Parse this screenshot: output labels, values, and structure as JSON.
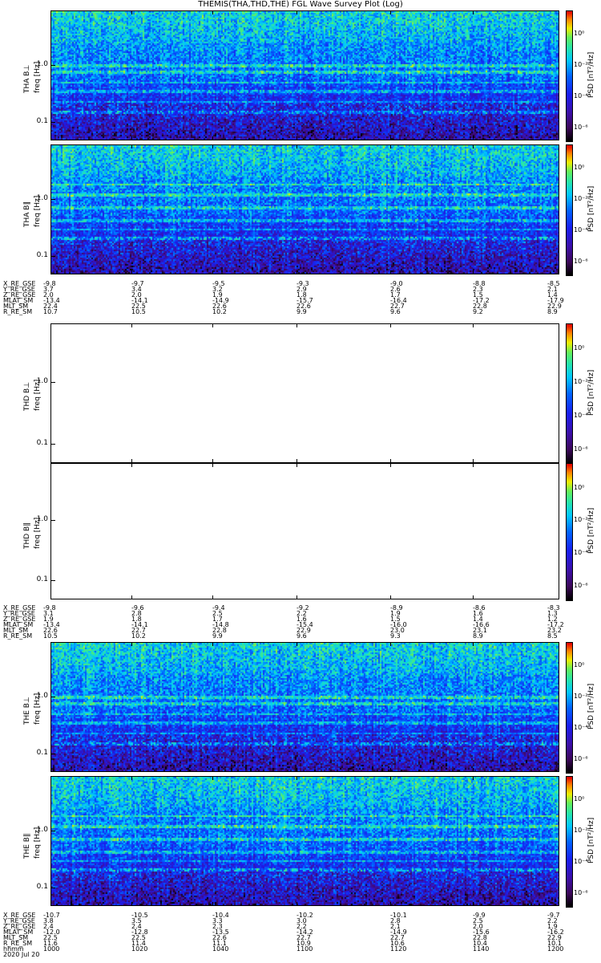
{
  "chart_data": {
    "type": "heatmap",
    "title": "THEMIS(THA,THD,THE) FGL Wave Survey Plot (Log)",
    "y_scale": "log",
    "y_tick_labels": [
      "1.0",
      "0.1"
    ],
    "colorbar": {
      "label": "PSD [nT²/Hz]",
      "scale": "log",
      "tick_labels": [
        "10⁰",
        "10⁻²",
        "10⁻⁴",
        "10⁻⁶"
      ],
      "colormap": [
        "#000000",
        "#3a0a5c",
        "#3a10a8",
        "#1e1ef0",
        "#0060ff",
        "#00c8ff",
        "#30e8a0",
        "#60f060",
        "#f0f000",
        "#ff8000",
        "#ff0000"
      ]
    },
    "panels": [
      {
        "probe_label": "THA B⊥",
        "freq_label": "freq [Hz]",
        "has_data": true
      },
      {
        "probe_label": "THA B∥",
        "freq_label": "freq [Hz]",
        "has_data": true
      },
      {
        "probe_label": "THD B⊥",
        "freq_label": "freq [Hz]",
        "has_data": false
      },
      {
        "probe_label": "THD B∥",
        "freq_label": "freq [Hz]",
        "has_data": false
      },
      {
        "probe_label": "THE B⊥",
        "freq_label": "freq [Hz]",
        "has_data": true
      },
      {
        "probe_label": "THE B∥",
        "freq_label": "freq [Hz]",
        "has_data": true
      }
    ],
    "ephemeris": [
      {
        "probe": "THA",
        "rows": [
          {
            "name": "X_RE_GSE",
            "values": [
              "-9.8",
              "-9.7",
              "-9.5",
              "-9.3",
              "-9.0",
              "-8.8",
              "-8.5"
            ]
          },
          {
            "name": "Y_RE_GSE",
            "values": [
              "3.7",
              "3.4",
              "3.2",
              "2.9",
              "2.6",
              "2.3",
              "2.1"
            ]
          },
          {
            "name": "Z_RE_GSE",
            "values": [
              "2.0",
              "2.0",
              "1.9",
              "1.8",
              "1.7",
              "1.5",
              "1.4"
            ]
          },
          {
            "name": "MLAT_SM",
            "values": [
              "-13.4",
              "-14.1",
              "-14.9",
              "-15.7",
              "-16.4",
              "-17.2",
              "-17.9"
            ]
          },
          {
            "name": "MLT_SM",
            "values": [
              "22.4",
              "22.5",
              "22.6",
              "22.6",
              "22.7",
              "22.8",
              "22.9"
            ]
          },
          {
            "name": "R_RE_SM",
            "values": [
              "10.7",
              "10.5",
              "10.2",
              "9.9",
              "9.6",
              "9.2",
              "8.9"
            ]
          }
        ]
      },
      {
        "probe": "THD",
        "rows": [
          {
            "name": "X_RE_GSE",
            "values": [
              "-9.8",
              "-9.6",
              "-9.4",
              "-9.2",
              "-8.9",
              "-8.6",
              "-8.3"
            ]
          },
          {
            "name": "Y_RE_GSE",
            "values": [
              "3.1",
              "2.8",
              "2.5",
              "2.2",
              "1.9",
              "1.6",
              "1.3"
            ]
          },
          {
            "name": "Z_RE_GSE",
            "values": [
              "1.9",
              "1.8",
              "1.7",
              "1.6",
              "1.5",
              "1.4",
              "1.2"
            ]
          },
          {
            "name": "MLAT_SM",
            "values": [
              "-13.4",
              "-14.1",
              "-14.8",
              "-15.4",
              "-16.0",
              "-16.6",
              "-17.2"
            ]
          },
          {
            "name": "MLT_SM",
            "values": [
              "22.6",
              "22.7",
              "22.8",
              "22.9",
              "23.0",
              "23.1",
              "23.2"
            ]
          },
          {
            "name": "R_RE_SM",
            "values": [
              "10.5",
              "10.2",
              "9.9",
              "9.6",
              "9.3",
              "8.9",
              "8.5"
            ]
          }
        ]
      },
      {
        "probe": "THE",
        "rows": [
          {
            "name": "X_RE_GSE",
            "values": [
              "-10.7",
              "-10.5",
              "-10.4",
              "-10.2",
              "-10.1",
              "-9.9",
              "-9.7"
            ]
          },
          {
            "name": "Y_RE_GSE",
            "values": [
              "3.8",
              "3.5",
              "3.3",
              "3.0",
              "2.8",
              "2.5",
              "2.2"
            ]
          },
          {
            "name": "Z_RE_GSE",
            "values": [
              "2.4",
              "2.4",
              "2.3",
              "2.2",
              "2.1",
              "2.0",
              "1.9"
            ]
          },
          {
            "name": "MLAT_SM",
            "values": [
              "-12.0",
              "-12.8",
              "-13.5",
              "-14.2",
              "-14.9",
              "-15.6",
              "-16.2"
            ]
          },
          {
            "name": "MLT_SM",
            "values": [
              "22.5",
              "22.5",
              "22.6",
              "22.7",
              "22.7",
              "22.8",
              "22.9"
            ]
          },
          {
            "name": "R_RE_SM",
            "values": [
              "11.6",
              "11.4",
              "11.1",
              "10.9",
              "10.6",
              "10.4",
              "10.1"
            ]
          },
          {
            "name": "hhmm",
            "values": [
              "1000",
              "1020",
              "1040",
              "1100",
              "1120",
              "1140",
              "1200"
            ]
          },
          {
            "name": "2020 Jul 20",
            "values": []
          }
        ]
      }
    ]
  }
}
